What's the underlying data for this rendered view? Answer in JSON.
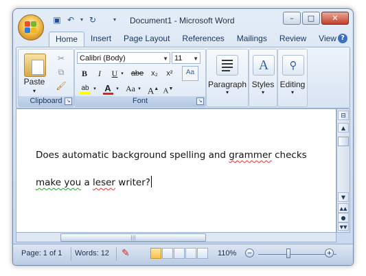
{
  "window": {
    "title": "Document1 - Microsoft Word",
    "buttons": {
      "minimize": "–",
      "maximize": "□",
      "close": "✕"
    }
  },
  "quick_access": {
    "undo_icon": "undo-icon",
    "redo_icon": "redo-icon",
    "save_icon": "save-icon"
  },
  "tabs": [
    {
      "label": "Home",
      "active": true
    },
    {
      "label": "Insert"
    },
    {
      "label": "Page Layout"
    },
    {
      "label": "References"
    },
    {
      "label": "Mailings"
    },
    {
      "label": "Review"
    },
    {
      "label": "View"
    }
  ],
  "ribbon": {
    "clipboard": {
      "label": "Clipboard",
      "paste": "Paste"
    },
    "font": {
      "label": "Font",
      "font_name": "Calibri (Body)",
      "font_size": "11",
      "bold": "B",
      "italic": "I",
      "underline": "U",
      "strikethrough": "abe",
      "subscript": "x₂",
      "superscript": "x²",
      "change_case": "Aa",
      "grow": "A",
      "shrink": "A"
    },
    "paragraph": {
      "label": "Paragraph"
    },
    "styles": {
      "label": "Styles"
    },
    "editing": {
      "label": "Editing"
    }
  },
  "document": {
    "line1": {
      "parts": [
        "Does automatic background spelling and ",
        "grammer",
        " checks"
      ]
    },
    "line2": {
      "parts": [
        "make you",
        " a ",
        "leser",
        " writer?"
      ]
    }
  },
  "status": {
    "page": "Page: 1 of 1",
    "words": "Words: 12",
    "zoom": "110%",
    "zoom_minus": "−",
    "zoom_plus": "+"
  },
  "colors": {
    "accent": "#2b579a",
    "highlight": "#ffff00",
    "font_color": "#e0201a"
  }
}
